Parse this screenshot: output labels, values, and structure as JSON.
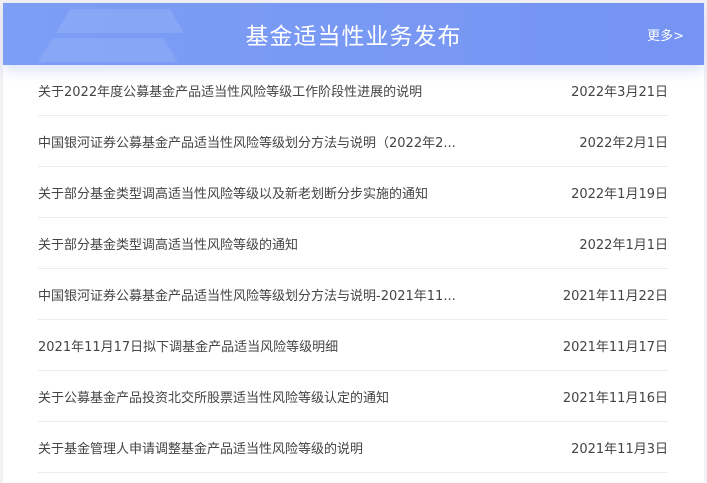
{
  "header": {
    "title": "基金适当性业务发布",
    "more_label": "更多>"
  },
  "items": [
    {
      "title": "关于2022年度公募基金产品适当性风险等级工作阶段性进展的说明",
      "date": "2022年3月21日"
    },
    {
      "title": "中国银河证券公募基金产品适当性风险等级划分方法与说明（2022年2...",
      "date": "2022年2月1日"
    },
    {
      "title": "关于部分基金类型调高适当性风险等级以及新老划断分步实施的通知",
      "date": "2022年1月19日"
    },
    {
      "title": "关于部分基金类型调高适当性风险等级的通知",
      "date": "2022年1月1日"
    },
    {
      "title": "中国银河证券公募基金产品适当性风险等级划分方法与说明-2021年11...",
      "date": "2021年11月22日"
    },
    {
      "title": "2021年11月17日拟下调基金产品适当风险等级明细",
      "date": "2021年11月17日"
    },
    {
      "title": "关于公募基金产品投资北交所股票适当性风险等级认定的通知",
      "date": "2021年11月16日"
    },
    {
      "title": "关于基金管理人申请调整基金产品适当性风险等级的说明",
      "date": "2021年11月3日"
    }
  ]
}
